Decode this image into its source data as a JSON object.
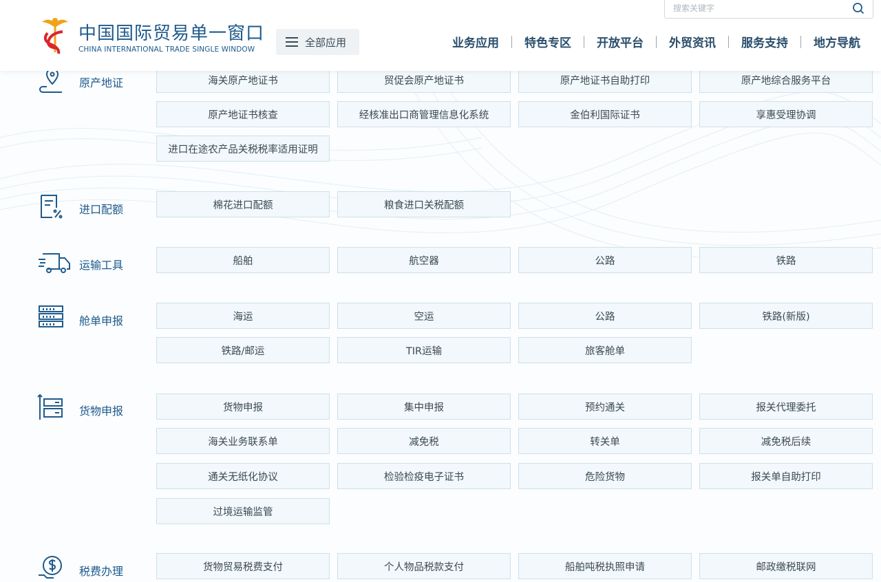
{
  "header": {
    "logo_title": "中国国际贸易单一窗口",
    "logo_subtitle": "CHINA INTERNATIONAL TRADE SINGLE WINDOW",
    "all_apps_label": "全部应用",
    "search_placeholder": "搜索关键字",
    "nav": [
      "业务应用",
      "特色专区",
      "开放平台",
      "外贸资讯",
      "服务支持",
      "地方导航"
    ]
  },
  "sections": [
    {
      "id": "origin",
      "title": "原产地证",
      "icon": "location-route-icon",
      "items": [
        "海关原产地证书",
        "贸促会原产地证书",
        "原产地证书自助打印",
        "原产地综合服务平台",
        "原产地证书核查",
        "经核准出口商管理信息化系统",
        "金伯利国际证书",
        "享惠受理协调",
        "进口在途农产品关税税率适用证明"
      ]
    },
    {
      "id": "quota",
      "title": "进口配额",
      "icon": "document-percent-icon",
      "items": [
        "棉花进口配额",
        "粮食进口关税配额"
      ]
    },
    {
      "id": "transport",
      "title": "运输工具",
      "icon": "truck-icon",
      "items": [
        "船舶",
        "航空器",
        "公路",
        "铁路"
      ]
    },
    {
      "id": "manifest",
      "title": "舱单申报",
      "icon": "server-rack-icon",
      "items": [
        "海运",
        "空运",
        "公路",
        "铁路(新版)",
        "铁路/邮运",
        "TIR运输",
        "旅客舱单"
      ]
    },
    {
      "id": "goods",
      "title": "货物申报",
      "icon": "stacked-boxes-icon",
      "items": [
        "货物申报",
        "集中申报",
        "预约通关",
        "报关代理委托",
        "海关业务联系单",
        "减免税",
        "转关单",
        "减免税后续",
        "通关无纸化协议",
        "检验检疫电子证书",
        "危险货物",
        "报关单自助打印",
        "过境运输监管"
      ]
    },
    {
      "id": "tax",
      "title": "税费办理",
      "icon": "tax-dollar-icon",
      "items": [
        "货物贸易税费支付",
        "个人物品税款支付",
        "船舶吨税执照申请",
        "邮政缴税联网"
      ]
    }
  ]
}
